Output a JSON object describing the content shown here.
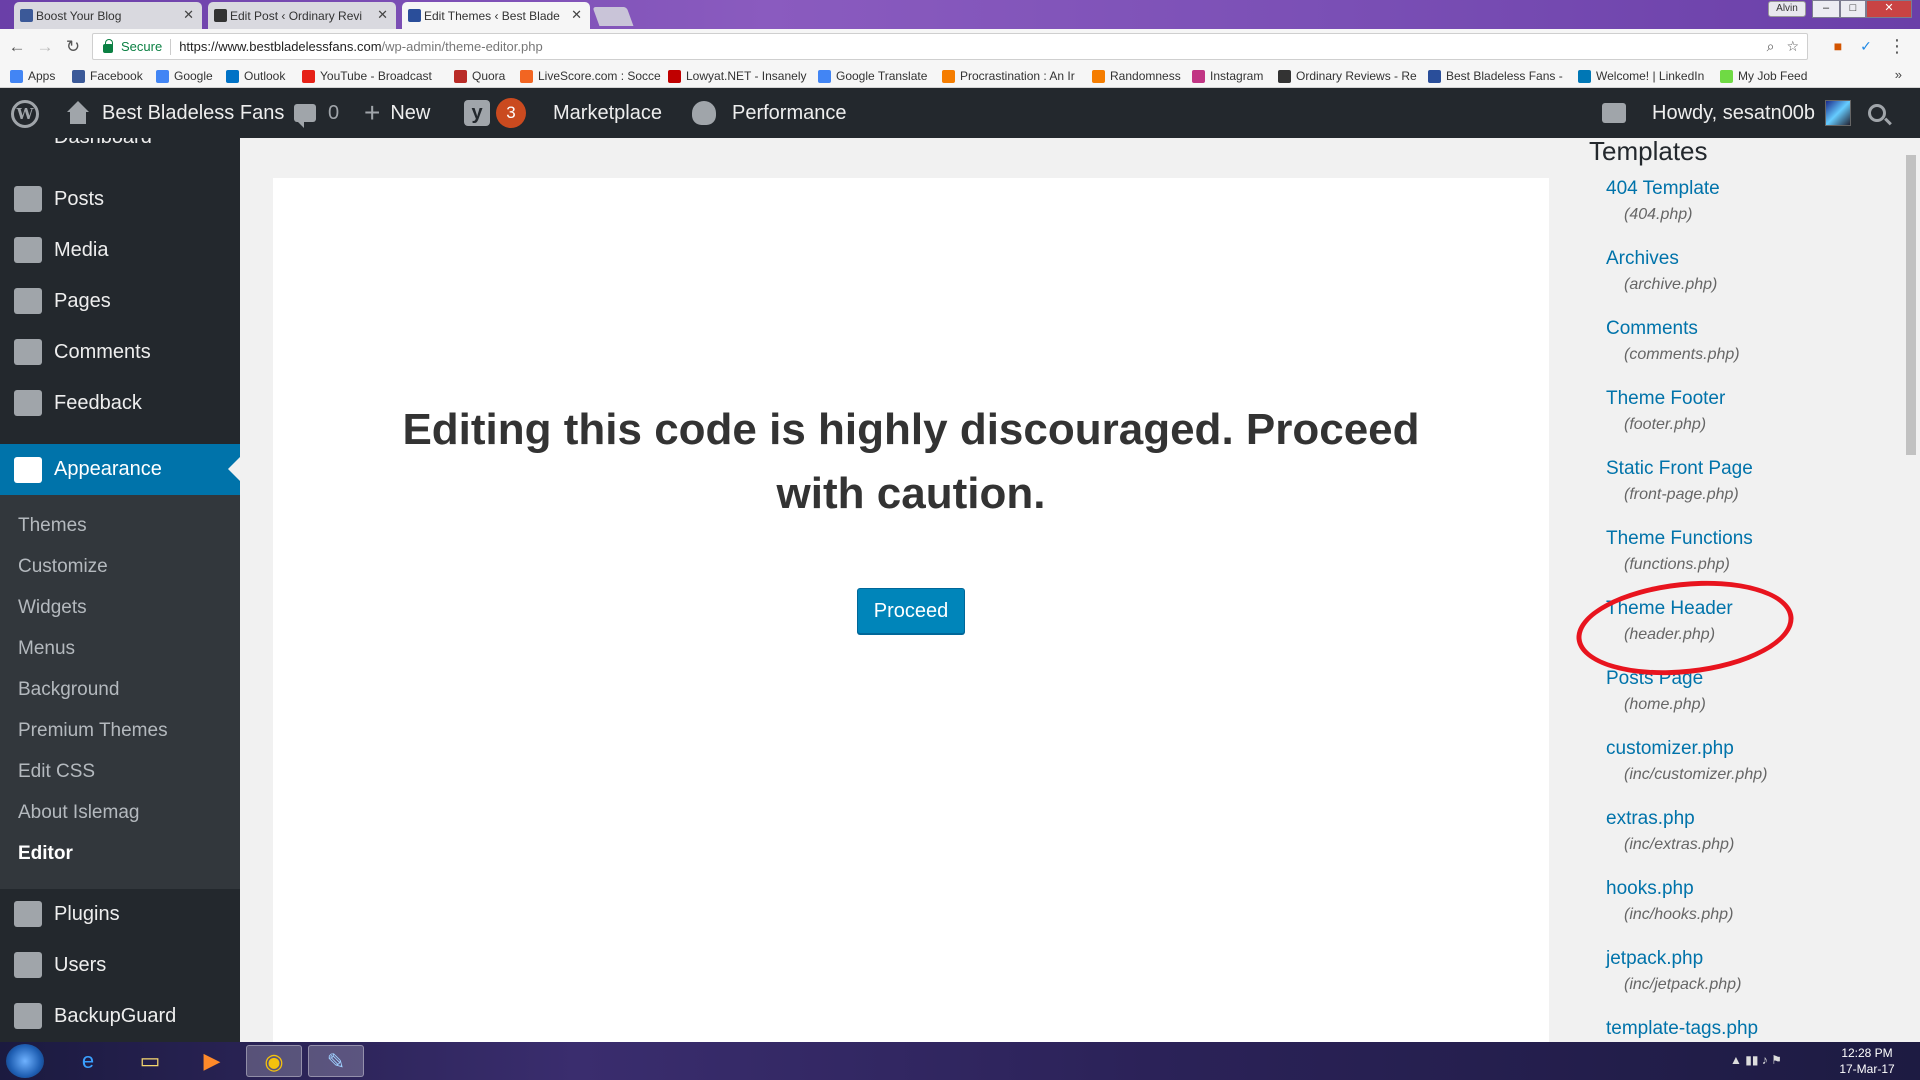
{
  "browser": {
    "tabs": [
      {
        "title": "Boost Your Blog",
        "favicon_color": "#3b5998"
      },
      {
        "title": "Edit Post ‹ Ordinary Revi",
        "favicon_color": "#333333"
      },
      {
        "title": "Edit Themes ‹ Best Blade",
        "favicon_color": "#2a4e9a"
      }
    ],
    "window_user": "Alvin",
    "secure_label": "Secure",
    "url_host": "https://www.bestbladelessfans.com",
    "url_path": "/wp-admin/theme-editor.php",
    "bookmarks": [
      {
        "label": "Apps",
        "color": "#4285f4"
      },
      {
        "label": "Facebook",
        "color": "#3b5998"
      },
      {
        "label": "Google",
        "color": "#4285f4"
      },
      {
        "label": "Outlook",
        "color": "#0072c6"
      },
      {
        "label": "YouTube - Broadcast",
        "color": "#e62117"
      },
      {
        "label": "Quora",
        "color": "#b92b27"
      },
      {
        "label": "LiveScore.com : Socce",
        "color": "#f26522"
      },
      {
        "label": "Lowyat.NET - Insanely",
        "color": "#c00000"
      },
      {
        "label": "Google Translate",
        "color": "#4285f4"
      },
      {
        "label": "Procrastination : An Ir",
        "color": "#f57d00"
      },
      {
        "label": "Randomness",
        "color": "#f57d00"
      },
      {
        "label": "Instagram",
        "color": "#c13584"
      },
      {
        "label": "Ordinary Reviews - Re",
        "color": "#333333"
      },
      {
        "label": "Best Bladeless Fans -",
        "color": "#2a4e9a"
      },
      {
        "label": "Welcome! | LinkedIn",
        "color": "#0077b5"
      },
      {
        "label": "My Job Feed",
        "color": "#6fda44"
      }
    ]
  },
  "adminbar": {
    "site_name": "Best Bladeless Fans",
    "comments_count": "0",
    "new_label": "New",
    "yoast_badge": "3",
    "marketplace_label": "Marketplace",
    "performance_label": "Performance",
    "howdy": "Howdy, sesatn00b"
  },
  "sidebar": {
    "cut_label": "Dashboard",
    "items_top": [
      {
        "label": "Posts"
      },
      {
        "label": "Media"
      },
      {
        "label": "Pages"
      },
      {
        "label": "Comments"
      },
      {
        "label": "Feedback"
      }
    ],
    "current": "Appearance",
    "submenu": [
      {
        "label": "Themes"
      },
      {
        "label": "Customize"
      },
      {
        "label": "Widgets"
      },
      {
        "label": "Menus"
      },
      {
        "label": "Background"
      },
      {
        "label": "Premium Themes"
      },
      {
        "label": "Edit CSS"
      },
      {
        "label": "About Islemag"
      },
      {
        "label": "Editor"
      }
    ],
    "items_bottom": [
      {
        "label": "Plugins"
      },
      {
        "label": "Users"
      },
      {
        "label": "BackupGuard"
      }
    ]
  },
  "main": {
    "warning": "Editing this code is highly discouraged. Proceed with caution.",
    "proceed_label": "Proceed"
  },
  "templates": {
    "heading": "Templates",
    "items": [
      {
        "name": "404 Template",
        "file": "(404.php)"
      },
      {
        "name": "Archives",
        "file": "(archive.php)"
      },
      {
        "name": "Comments",
        "file": "(comments.php)"
      },
      {
        "name": "Theme Footer",
        "file": "(footer.php)"
      },
      {
        "name": "Static Front Page",
        "file": "(front-page.php)"
      },
      {
        "name": "Theme Functions",
        "file": "(functions.php)"
      },
      {
        "name": "Theme Header",
        "file": "(header.php)"
      },
      {
        "name": "Posts Page",
        "file": "(home.php)"
      },
      {
        "name": "customizer.php",
        "file": "(inc/customizer.php)"
      },
      {
        "name": "extras.php",
        "file": "(inc/extras.php)"
      },
      {
        "name": "hooks.php",
        "file": "(inc/hooks.php)"
      },
      {
        "name": "jetpack.php",
        "file": "(inc/jetpack.php)"
      },
      {
        "name": "template-tags.php",
        "file": ""
      }
    ]
  },
  "taskbar": {
    "time": "12:28 PM",
    "date": "17-Mar-17"
  },
  "colors": {
    "admin_bar": "#23282d",
    "accent": "#0073aa",
    "button": "#0085ba",
    "annotation": "#e8141e"
  }
}
